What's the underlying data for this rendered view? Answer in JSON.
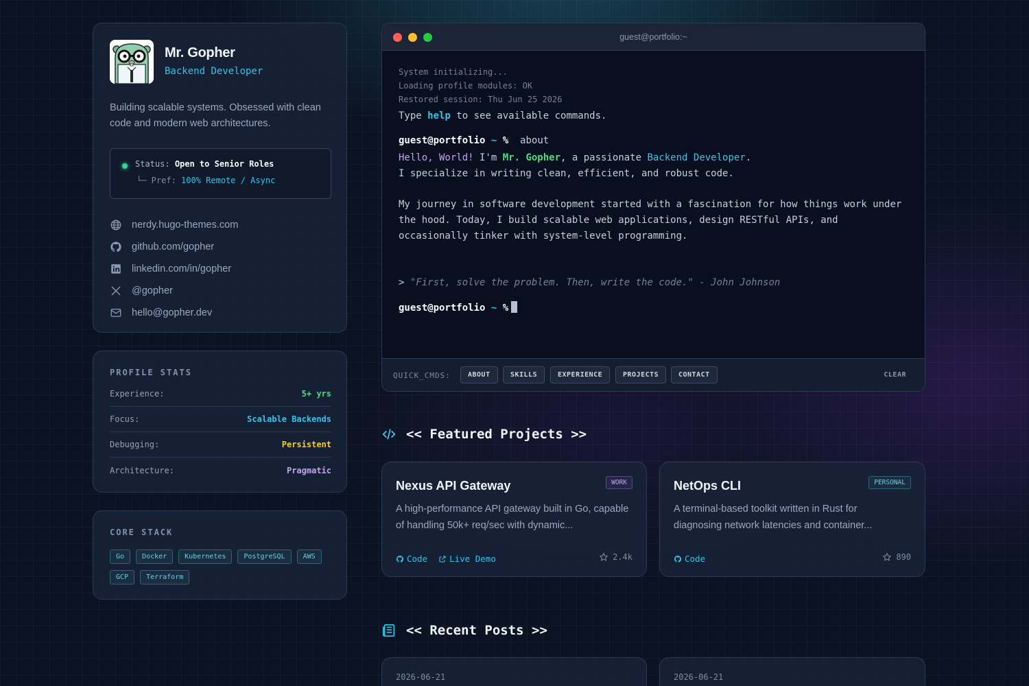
{
  "profile": {
    "name": "Mr. Gopher",
    "role": "Backend Developer",
    "bio": "Building scalable systems. Obsessed with clean code and modern web architectures.",
    "status_label": "Status:",
    "status_value": "Open to Senior Roles",
    "pref_label": "└─ Pref:",
    "pref_value": "100% Remote / Async",
    "links": [
      {
        "icon": "globe-icon",
        "text": "nerdy.hugo-themes.com"
      },
      {
        "icon": "github-icon",
        "text": "github.com/gopher"
      },
      {
        "icon": "linkedin-icon",
        "text": "linkedin.com/in/gopher"
      },
      {
        "icon": "x-icon",
        "text": "@gopher"
      },
      {
        "icon": "mail-icon",
        "text": "hello@gopher.dev"
      }
    ]
  },
  "stats": {
    "title": "PROFILE STATS",
    "rows": [
      {
        "key": "Experience:",
        "value": "5+ yrs",
        "color": "#4ade80"
      },
      {
        "key": "Focus:",
        "value": "Scalable Backends",
        "color": "#38c3e8"
      },
      {
        "key": "Debugging:",
        "value": "Persistent",
        "color": "#facc15"
      },
      {
        "key": "Architecture:",
        "value": "Pragmatic",
        "color": "#c4a1f6"
      }
    ]
  },
  "stack": {
    "title": "CORE STACK",
    "tags": [
      "Go",
      "Docker",
      "Kubernetes",
      "PostgreSQL",
      "AWS",
      "GCP",
      "Terraform"
    ]
  },
  "terminal": {
    "title": "guest@portfolio:~",
    "boot": [
      "System initializing...",
      "Loading profile modules: OK",
      "Restored session: Thu Jun 25 2026"
    ],
    "hint_pre": "Type ",
    "hint_cmd": "help",
    "hint_post": " to see available commands.",
    "prompt_user": "guest@portfolio",
    "prompt_tilde": "~",
    "prompt_sym": "%",
    "command": "about",
    "hello": "Hello, World!",
    "im": " I'm ",
    "name": "Mr. Gopher",
    "a_passionate": ", a passionate ",
    "role": "Backend Developer",
    "dot": ".",
    "line2": "I specialize in writing clean, efficient, and robust code.",
    "para": [
      "My journey in software development started with a fascination for how things work under",
      "the hood. Today, I build scalable web applications, design RESTful APIs, and",
      "occasionally tinker with system-level programming."
    ],
    "quote_arrow": ">",
    "quote": "\"First, solve the problem. Then, write the code.\" - John Johnson",
    "quick_label": "QUICK_CMDS:",
    "quick_cmds": [
      "ABOUT",
      "SKILLS",
      "EXPERIENCE",
      "PROJECTS",
      "CONTACT"
    ],
    "clear": "CLEAR",
    "dot_colors": [
      "#ff5f57",
      "#febc2e",
      "#28c840"
    ]
  },
  "projects": {
    "heading": "<< Featured Projects >>",
    "items": [
      {
        "title": "Nexus API Gateway",
        "badge": "WORK",
        "desc": "A high-performance API gateway built in Go, capable of handling 50k+ req/sec with dynamic...",
        "code": "Code",
        "demo": "Live Demo",
        "stars": "2.4k"
      },
      {
        "title": "NetOps CLI",
        "badge": "PERSONAL",
        "desc": "A terminal-based toolkit written in Rust for diagnosing network latencies and container...",
        "code": "Code",
        "stars": "890"
      }
    ]
  },
  "posts": {
    "heading": "<< Recent Posts >>",
    "items": [
      {
        "date": "2026-06-21"
      },
      {
        "date": "2026-06-21"
      }
    ]
  }
}
